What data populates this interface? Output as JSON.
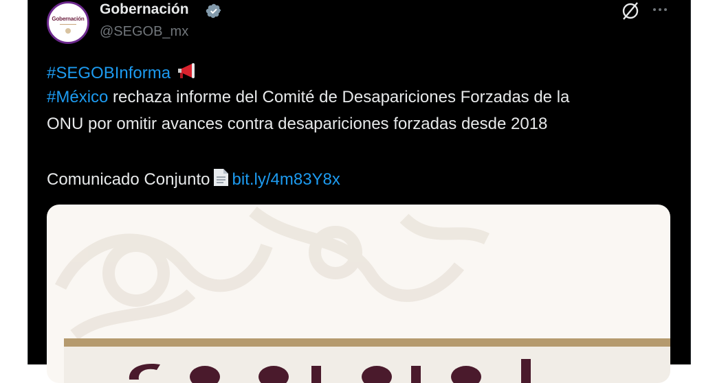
{
  "author": {
    "display_name": "Gobernación",
    "handle": "@SEGOB_mx",
    "avatar_label": "Gobernación",
    "verified": true
  },
  "icons": {
    "grok": "grok-icon",
    "more": "more-icon",
    "verified": "verified-badge-icon",
    "megaphone": "megaphone-emoji",
    "document": "page-emoji"
  },
  "tweet": {
    "hashtag_1": "#SEGOBInforma",
    "hashtag_2": "#México",
    "line2_rest": " rechaza informe del Comité de Desapariciones Forzadas de la",
    "line3": "ONU por omitir avances contra desapariciones forzadas desde 2018",
    "line5_prefix": "Comunicado Conjunto",
    "link": "bit.ly/4m83Y8x"
  },
  "colors": {
    "background": "#000000",
    "text": "#e7e9ea",
    "muted": "#71767b",
    "link": "#1d9bf0",
    "verified": "#829aab"
  }
}
